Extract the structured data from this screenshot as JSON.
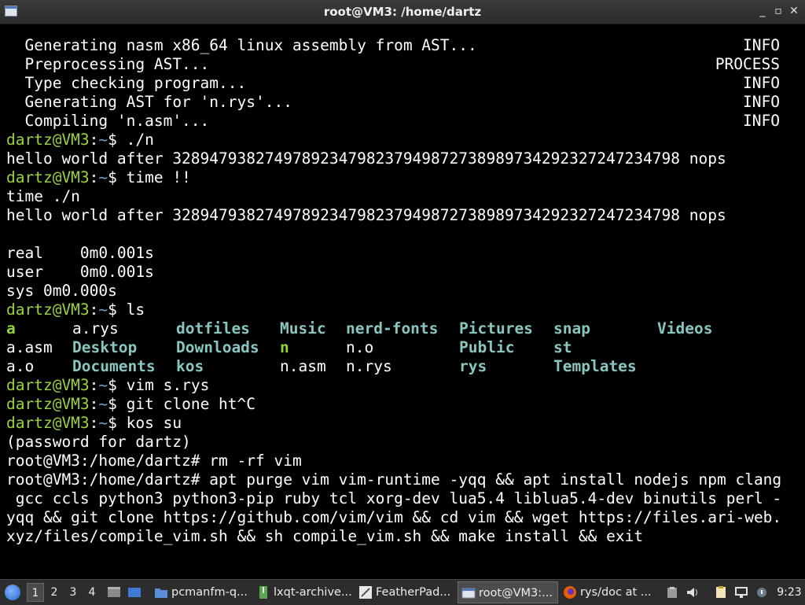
{
  "window": {
    "title": "root@VM3: /home/dartz",
    "buttons": [
      "_",
      "▫",
      "✕"
    ]
  },
  "terminal": {
    "lines": [
      {
        "text": "  Generating nasm x86_64 linux assembly from AST...",
        "tag": "INFO"
      },
      {
        "text": "  Preprocessing AST...",
        "tag": "PROCESS"
      },
      {
        "text": "  Type checking program...",
        "tag": "INFO"
      },
      {
        "text": "  Generating AST for 'n.rys'...",
        "tag": "INFO"
      },
      {
        "text": "  Compiling 'n.asm'...",
        "tag": "INFO"
      },
      {
        "user": "dartz@VM3",
        "path": "~",
        "cmd": "$ ./n"
      },
      {
        "text": "hello world after 3289479382749789234798237949872738989734292327247234798 nops"
      },
      {
        "user": "dartz@VM3",
        "path": "~",
        "cmd": "$ time !!"
      },
      {
        "text": "time ./n"
      },
      {
        "text": "hello world after 3289479382749789234798237949872738989734292327247234798 nops"
      },
      {
        "text": ""
      },
      {
        "text": "real    0m0.001s"
      },
      {
        "text": "user    0m0.001s"
      },
      {
        "text": "sys 0m0.000s"
      },
      {
        "user": "dartz@VM3",
        "path": "~",
        "cmd": "$ ls"
      },
      {
        "ls_row": 0
      },
      {
        "ls_row": 1
      },
      {
        "ls_row": 2
      },
      {
        "user": "dartz@VM3",
        "path": "~",
        "cmd": "$ vim s.rys"
      },
      {
        "user": "dartz@VM3",
        "path": "~",
        "cmd": "$ git clone ht^C"
      },
      {
        "user": "dartz@VM3",
        "path": "~",
        "cmd": "$ kos su"
      },
      {
        "text": "(password for dartz)"
      },
      {
        "text": "root@VM3:/home/dartz# rm -rf vim"
      },
      {
        "text": "root@VM3:/home/dartz# apt purge vim vim-runtime -yqq && apt install nodejs npm clang"
      },
      {
        "text": " gcc ccls python3 python3-pip ruby tcl xorg-dev lua5.4 liblua5.4-dev binutils perl -"
      },
      {
        "text": "yqq && git clone https://github.com/vim/vim && cd vim && wget https://files.ari-web."
      },
      {
        "text": "xyz/files/compile_vim.sh && sh compile_vim.sh && make install && exit"
      },
      {
        "text": ""
      },
      {
        "text": "_"
      }
    ],
    "ls_rows": [
      [
        {
          "name": "a",
          "kind": "exec"
        },
        {
          "name": "a.rys",
          "kind": "file"
        },
        {
          "name": "dotfiles",
          "kind": "dir"
        },
        {
          "name": "Music",
          "kind": "dir"
        },
        {
          "name": "nerd-fonts",
          "kind": "dir"
        },
        {
          "name": "Pictures",
          "kind": "dir"
        },
        {
          "name": "snap",
          "kind": "dir"
        },
        {
          "name": "Videos",
          "kind": "dir"
        }
      ],
      [
        {
          "name": "a.asm",
          "kind": "file"
        },
        {
          "name": "Desktop",
          "kind": "dir"
        },
        {
          "name": "Downloads",
          "kind": "dir"
        },
        {
          "name": "n",
          "kind": "exec"
        },
        {
          "name": "n.o",
          "kind": "file"
        },
        {
          "name": "Public",
          "kind": "dir"
        },
        {
          "name": "st",
          "kind": "dir"
        },
        {
          "name": "",
          "kind": "file"
        }
      ],
      [
        {
          "name": "a.o",
          "kind": "file"
        },
        {
          "name": "Documents",
          "kind": "dir"
        },
        {
          "name": "kos",
          "kind": "dir"
        },
        {
          "name": "n.asm",
          "kind": "file"
        },
        {
          "name": "n.rys",
          "kind": "file"
        },
        {
          "name": "rys",
          "kind": "dir"
        },
        {
          "name": "Templates",
          "kind": "dir"
        },
        {
          "name": "",
          "kind": "file"
        }
      ]
    ]
  },
  "taskbar": {
    "workspaces": [
      "1",
      "2",
      "3",
      "4"
    ],
    "active_workspace": "1",
    "tasks": [
      {
        "label": "pcmanfm-q...",
        "icon": "folder-icon"
      },
      {
        "label": "lxqt-archive...",
        "icon": "archive-icon"
      },
      {
        "label": "FeatherPad...",
        "icon": "featherpad-icon"
      },
      {
        "label": "root@VM3:...",
        "icon": "terminal-icon",
        "active": true
      },
      {
        "label": "rys/doc at ...",
        "icon": "firefox-icon"
      }
    ],
    "clock": "9:23",
    "colors": {
      "bar": "#2d2d2d",
      "prompt_user": "#9bd13b",
      "prompt_path": "#6fa0d0",
      "ls_dir": "#8ac6c0",
      "ls_exec": "#8fd43d"
    }
  }
}
